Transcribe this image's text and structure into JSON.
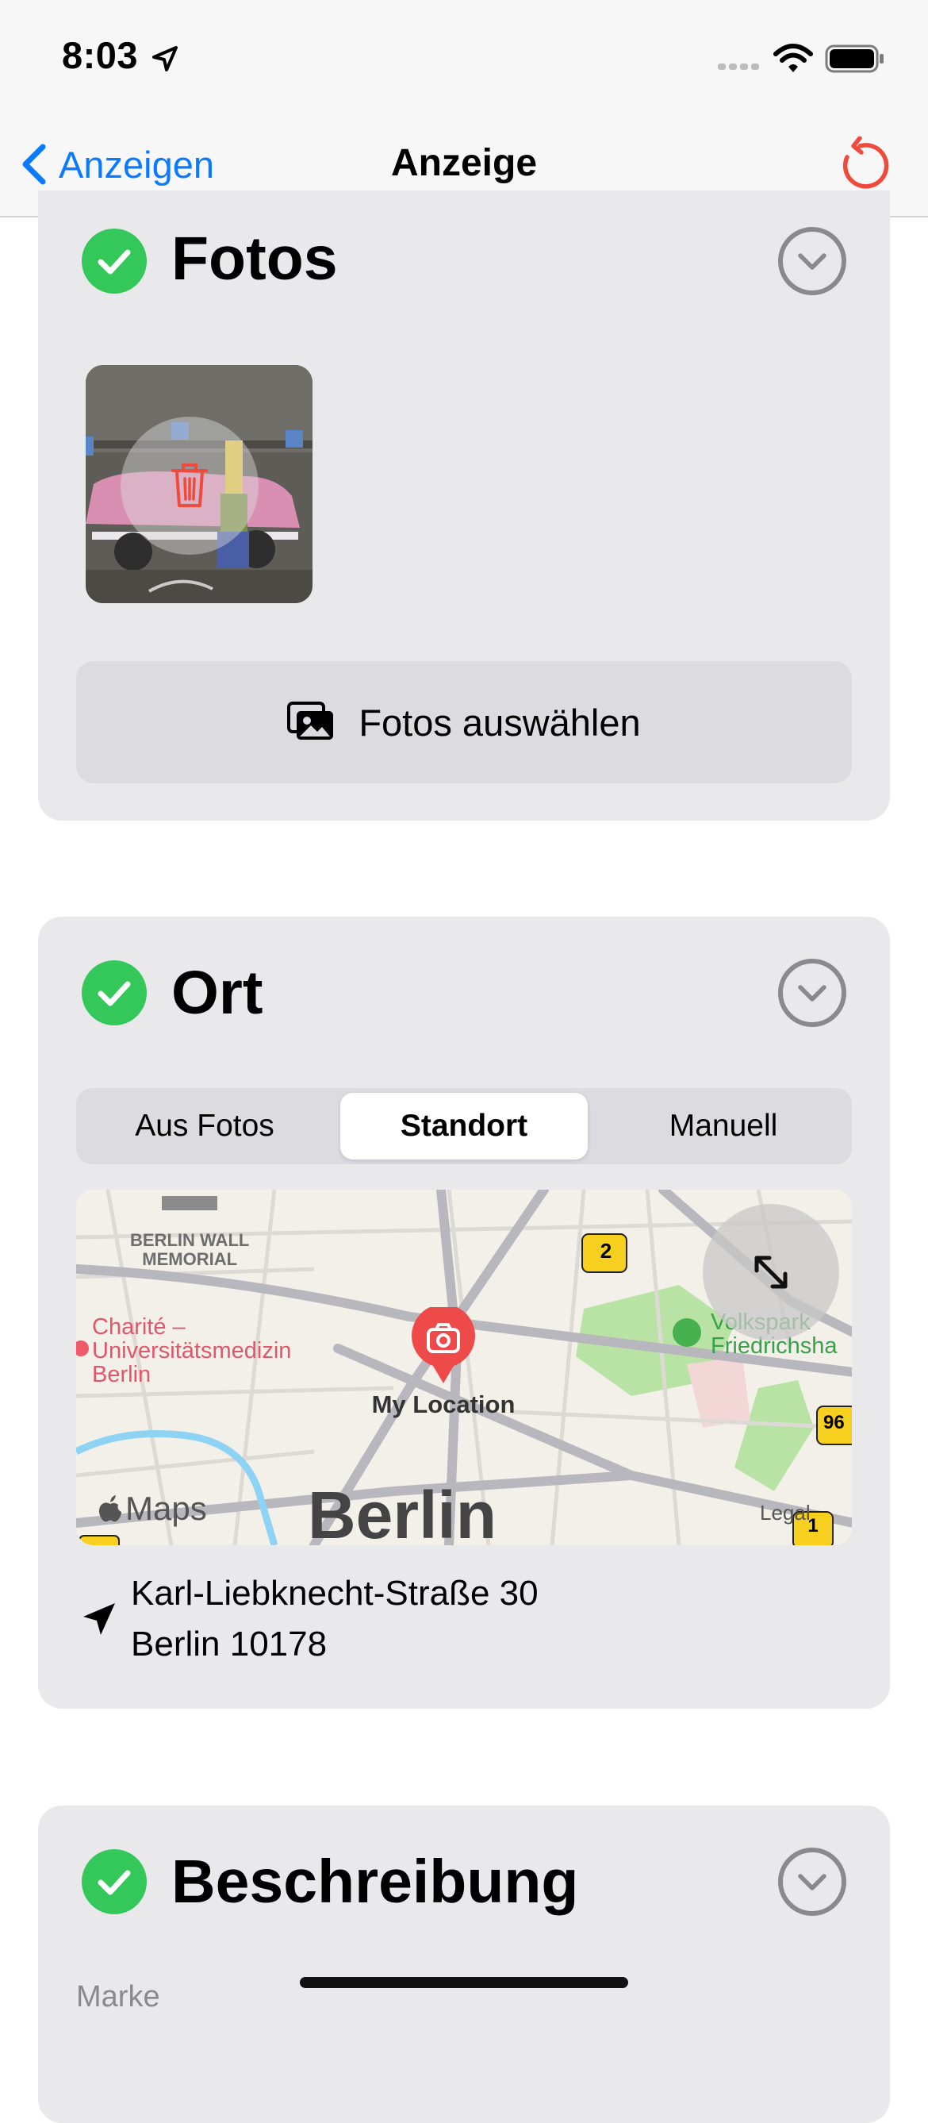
{
  "status_bar": {
    "time": "8:03"
  },
  "nav": {
    "back_label": "Anzeigen",
    "title": "Anzeige"
  },
  "sections": {
    "fotos": {
      "title": "Fotos",
      "select_button_label": "Fotos auswählen"
    },
    "ort": {
      "title": "Ort",
      "segments": [
        "Aus Fotos",
        "Standort",
        "Manuell"
      ],
      "selected_segment": "Standort",
      "map": {
        "memorial_label_1": "BERLIN WALL",
        "memorial_label_2": "MEMORIAL",
        "hospital_line_1": "Charité –",
        "hospital_line_2": "Universitätsmedizin",
        "hospital_line_3": "Berlin",
        "park_line_1": "Volkspark",
        "park_line_2": "Friedrichsha",
        "pin_label": "My Location",
        "city_label": "Berlin",
        "maps_logo": "Maps",
        "legal_label": "Legal",
        "road_badge_1": "2",
        "road_badge_2": "96",
        "road_badge_3": "1"
      },
      "address_line_1": "Karl-Liebknecht-Straße 30",
      "address_line_2": "Berlin 10178"
    },
    "beschreibung": {
      "title": "Beschreibung",
      "first_field_label": "Marke"
    }
  },
  "colors": {
    "accent": "#0a7aff",
    "destructive": "#ef4a3b",
    "success": "#34c759",
    "card_bg": "#e9e9ec",
    "map_pin": "#ef4a4a"
  },
  "icons": {
    "back": "chevron-left-icon",
    "refresh": "arrow-counterclockwise-icon",
    "check": "checkmark-icon",
    "collapse": "chevron-down-icon",
    "delete": "trash-icon",
    "photo_picker": "photo-stack-icon",
    "expand_map": "expand-arrows-icon",
    "location": "location-arrow-icon"
  }
}
